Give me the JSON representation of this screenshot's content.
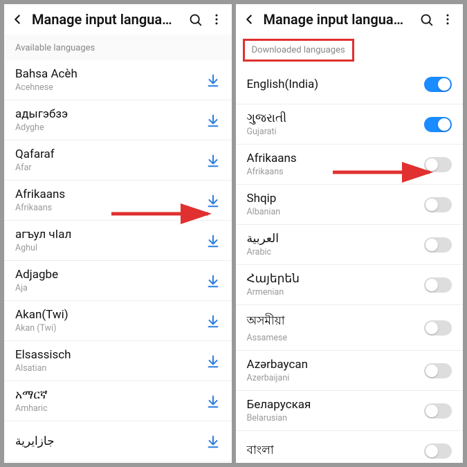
{
  "left": {
    "header_title": "Manage input langua…",
    "section_label": "Available languages",
    "items": [
      {
        "primary": "Bahsa Acèh",
        "secondary": "Acehnese"
      },
      {
        "primary": "адыгэбзэ",
        "secondary": "Adyghe"
      },
      {
        "primary": "Qafaraf",
        "secondary": "Afar"
      },
      {
        "primary": "Afrikaans",
        "secondary": "Afrikaans"
      },
      {
        "primary": "агъул чӏал",
        "secondary": "Aghul"
      },
      {
        "primary": "Adjagbe",
        "secondary": "Aja"
      },
      {
        "primary": "Akan(Twi)",
        "secondary": "Akan (Twi)"
      },
      {
        "primary": "Elsassisch",
        "secondary": "Alsatian"
      },
      {
        "primary": "አማርኛ",
        "secondary": "Amharic"
      },
      {
        "primary": "جازايرية",
        "secondary": ""
      }
    ]
  },
  "right": {
    "header_title": "Manage input langua…",
    "section_label": "Downloaded languages",
    "items": [
      {
        "primary": "English(India)",
        "secondary": "",
        "on": true
      },
      {
        "primary": "ગુજરાતી",
        "secondary": "Gujarati",
        "on": true
      },
      {
        "primary": "Afrikaans",
        "secondary": "Afrikaans",
        "on": false
      },
      {
        "primary": "Shqip",
        "secondary": "Albanian",
        "on": false
      },
      {
        "primary": "العربية",
        "secondary": "Arabic",
        "on": false
      },
      {
        "primary": "Հայերեն",
        "secondary": "Armenian",
        "on": false
      },
      {
        "primary": "অসমীয়া",
        "secondary": "Assamese",
        "on": false
      },
      {
        "primary": "Azərbaycan",
        "secondary": "Azerbaijani",
        "on": false
      },
      {
        "primary": "Беларуская",
        "secondary": "Belarusian",
        "on": false
      },
      {
        "primary": "বাংলা",
        "secondary": "",
        "on": false
      }
    ]
  },
  "icons": {
    "back": "back-icon",
    "search": "search-icon",
    "more": "more-icon",
    "download": "download-icon"
  },
  "colors": {
    "accent": "#1a8cff",
    "download": "#2a7de1",
    "highlight_box": "#e03030",
    "arrow": "#e03030"
  }
}
